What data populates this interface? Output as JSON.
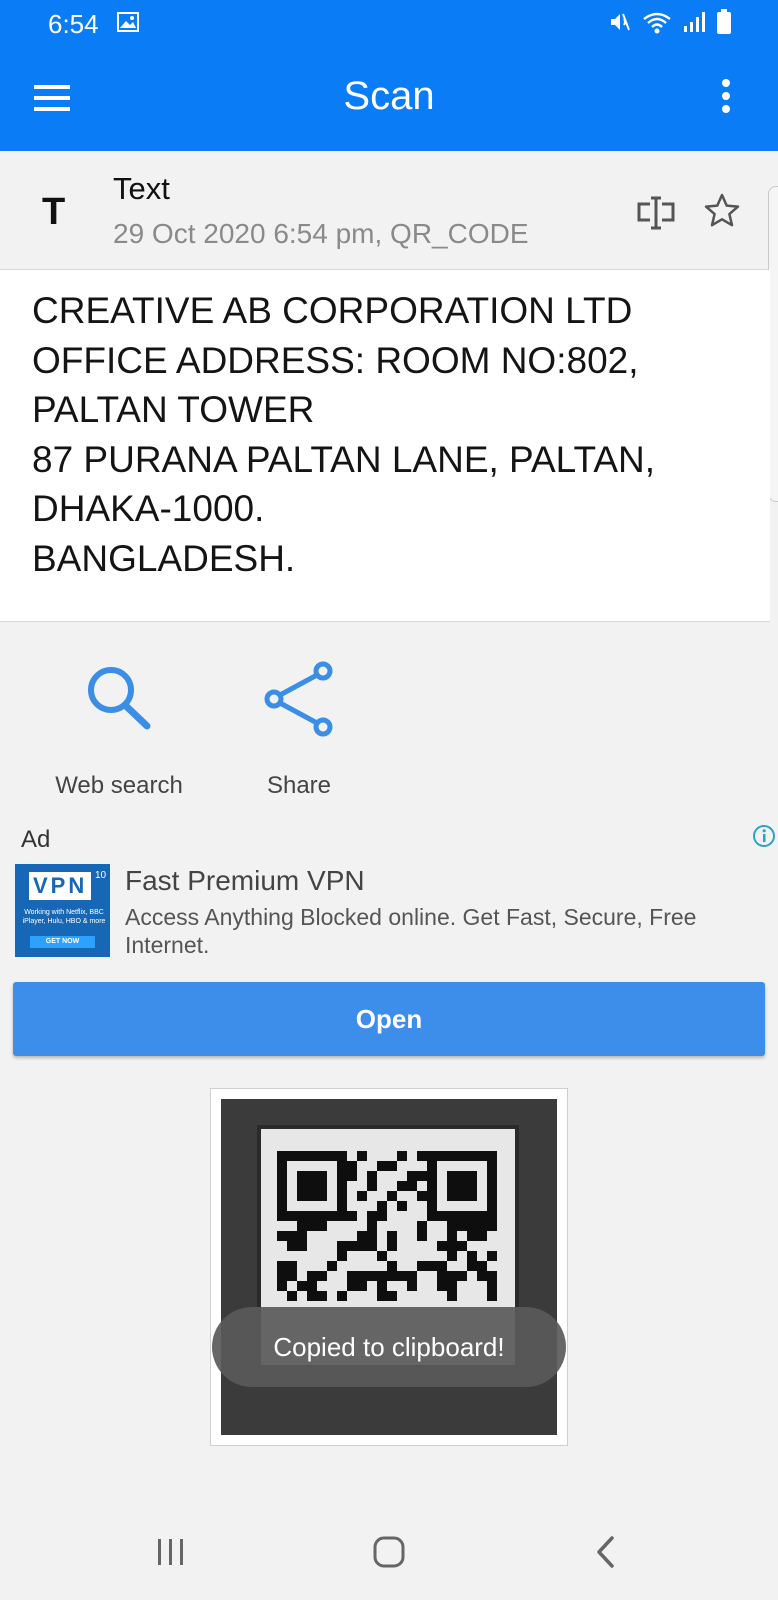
{
  "status_bar": {
    "time": "6:54",
    "icons": [
      "gallery-icon",
      "mute-icon",
      "wifi-icon",
      "signal-icon",
      "battery-icon"
    ]
  },
  "app_bar": {
    "title": "Scan",
    "icons": [
      "hamburger-menu-icon",
      "more-vert-icon"
    ]
  },
  "result": {
    "type_badge": "T",
    "type": "Text",
    "meta": "29 Oct 2020 6:54 pm, QR_CODE",
    "content": "CREATIVE AB CORPORATION LTD\nOFFICE ADDRESS: ROOM NO:802,\nPALTAN TOWER\n87 PURANA PALTAN LANE, PALTAN,\nDHAKA-1000.\nBANGLADESH.",
    "header_icons": [
      "edit-text-icon",
      "star-icon"
    ]
  },
  "actions": [
    {
      "label": "Web search",
      "icon": "search-icon"
    },
    {
      "label": "Share",
      "icon": "share-icon"
    }
  ],
  "ad": {
    "label": "Ad",
    "banner_brand": "VPN",
    "banner_sup": "10",
    "banner_small": "Working with Netflix, BBC iPlayer, Hulu, HBO & more",
    "banner_cta": "GET NOW",
    "title": "Fast Premium VPN",
    "description": "Access Anything Blocked online. Get Fast, Secure, Free Internet.",
    "button": "Open"
  },
  "toast": "Copied to clipboard!",
  "nav_bar": [
    "recents-icon",
    "home-icon",
    "back-icon"
  ],
  "colors": {
    "app_bar": "#0a7cf5",
    "action_icon": "#3b8ee6",
    "ad_button": "#3c8eea"
  }
}
